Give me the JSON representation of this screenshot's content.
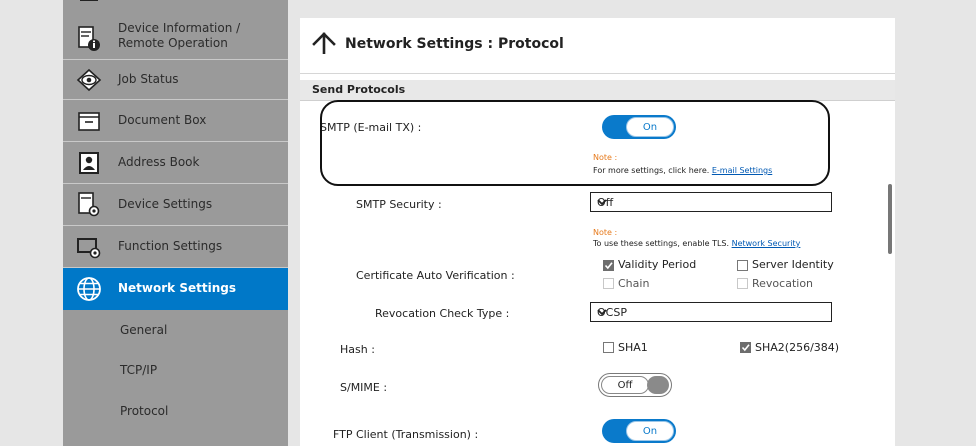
{
  "sidebar": {
    "items": [
      {
        "label": "Device Information /",
        "label2": "Remote Operation",
        "icon": "device-info-icon"
      },
      {
        "label": "Job Status",
        "icon": "eye-icon"
      },
      {
        "label": "Document Box",
        "icon": "document-box-icon"
      },
      {
        "label": "Address Book",
        "icon": "address-book-icon"
      },
      {
        "label": "Device Settings",
        "icon": "device-settings-icon"
      },
      {
        "label": "Function Settings",
        "icon": "function-settings-icon"
      },
      {
        "label": "Network Settings",
        "icon": "globe-icon",
        "active": true
      }
    ],
    "subitems": [
      {
        "label": "General"
      },
      {
        "label": "TCP/IP"
      },
      {
        "label": "Protocol"
      }
    ],
    "active_color": "#0078c8"
  },
  "header": {
    "title": "Network Settings : Protocol"
  },
  "section": {
    "title": "Send Protocols"
  },
  "smtp": {
    "label": "SMTP (E-mail TX) :",
    "toggle": "On",
    "note_label": "Note :",
    "note_text": "For more settings, click here. ",
    "note_link": "E-mail Settings"
  },
  "smtp_security": {
    "label": "SMTP Security :",
    "value": "Off",
    "note_label": "Note :",
    "note_text": "To use these settings, enable TLS. ",
    "note_link": "Network Security"
  },
  "cert": {
    "label": "Certificate Auto Verification :",
    "options": [
      {
        "label": "Validity Period",
        "checked": true,
        "disabled": false
      },
      {
        "label": "Server Identity",
        "checked": false,
        "disabled": false
      },
      {
        "label": "Chain",
        "checked": false,
        "disabled": true
      },
      {
        "label": "Revocation",
        "checked": false,
        "disabled": true
      }
    ]
  },
  "revocation": {
    "label": "Revocation Check Type :",
    "value": "OCSP"
  },
  "hash": {
    "label": "Hash :",
    "options": [
      {
        "label": "SHA1",
        "checked": false
      },
      {
        "label": "SHA2(256/384)",
        "checked": true
      }
    ]
  },
  "smime": {
    "label": "S/MIME :",
    "toggle": "Off"
  },
  "ftp": {
    "label": "FTP Client (Transmission) :",
    "toggle": "On"
  }
}
